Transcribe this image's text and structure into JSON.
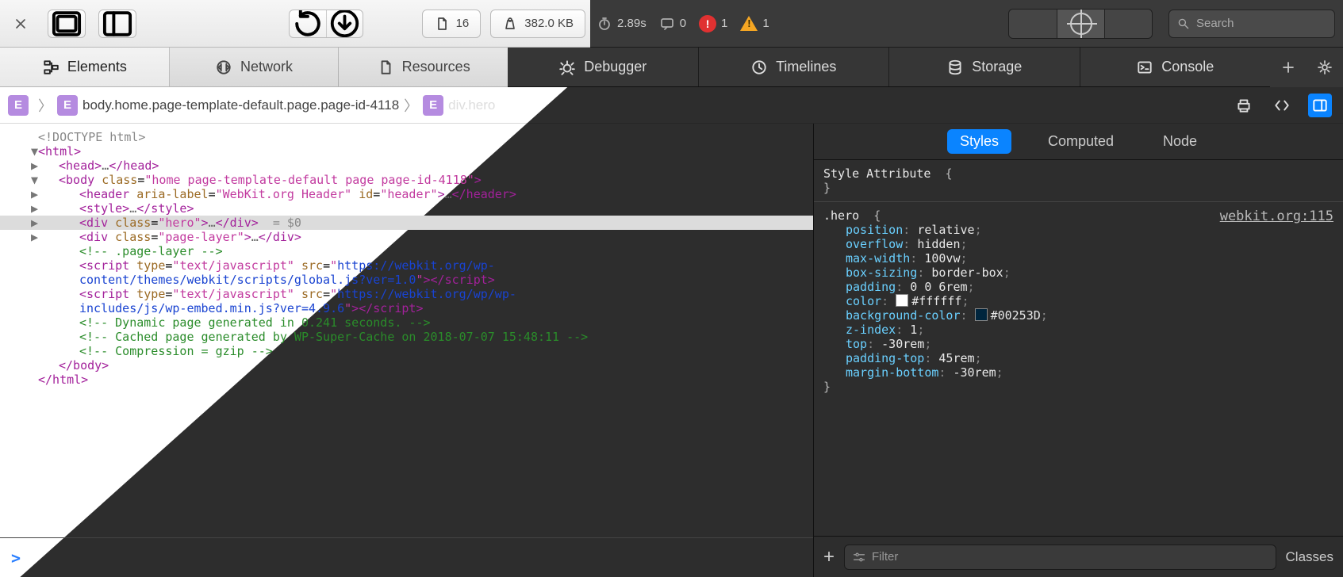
{
  "toolbar": {
    "doc_count": "16",
    "weight": "382.0 KB",
    "load_time": "2.89s",
    "msg_count": "0",
    "error_count": "1",
    "warn_count": "1",
    "search_placeholder": "Search"
  },
  "tabs": {
    "elements": "Elements",
    "network": "Network",
    "resources": "Resources",
    "debugger": "Debugger",
    "timelines": "Timelines",
    "storage": "Storage",
    "console": "Console"
  },
  "breadcrumb": {
    "root": "E",
    "body": "body.home.page-template-default.page.page-id-4118",
    "node": "div.hero"
  },
  "dom": {
    "doctype": "<!DOCTYPE html>",
    "html_open": "html",
    "head": "head",
    "body_class": "home page-template-default page page-id-4118",
    "header_aria": "WebKit.org Header",
    "header_id": "header",
    "style": "style",
    "hero_class": "hero",
    "hero_tail": "= $0",
    "pagelayer_class": "page-layer",
    "c_pagelayer": "<!-- .page-layer -->",
    "script1_type": "text/javascript",
    "script1_src": "https://webkit.org/wp-content/themes/webkit/scripts/global.js?ver=1.0",
    "script2_type": "text/javascript",
    "script2_src": "https://webkit.org/wp/wp-includes/js/wp-embed.min.js?ver=4.9.6",
    "c_dyn": "<!-- Dynamic page generated in 0.241 seconds. -->",
    "c_cache": "<!-- Cached page generated by WP-Super-Cache on 2018-07-07 15:48:11 -->",
    "c_gzip": "<!-- Compression = gzip -->"
  },
  "side": {
    "tabs": {
      "styles": "Styles",
      "computed": "Computed",
      "node": "Node"
    },
    "attr_header": "Style Attribute",
    "rule": {
      "selector": ".hero",
      "source": "webkit.org:115",
      "props": [
        {
          "n": "position",
          "v": "relative"
        },
        {
          "n": "overflow",
          "v": "hidden"
        },
        {
          "n": "max-width",
          "v": "100vw"
        },
        {
          "n": "box-sizing",
          "v": "border-box"
        },
        {
          "n": "padding",
          "v": "0 0 6rem"
        },
        {
          "n": "color",
          "v": "#ffffff",
          "swatch": "#ffffff"
        },
        {
          "n": "background-color",
          "v": "#00253D",
          "swatch": "#00253D"
        },
        {
          "n": "z-index",
          "v": "1"
        },
        {
          "n": "top",
          "v": "-30rem"
        },
        {
          "n": "padding-top",
          "v": "45rem"
        },
        {
          "n": "margin-bottom",
          "v": "-30rem"
        }
      ]
    },
    "filter_placeholder": "Filter",
    "classes_label": "Classes"
  }
}
